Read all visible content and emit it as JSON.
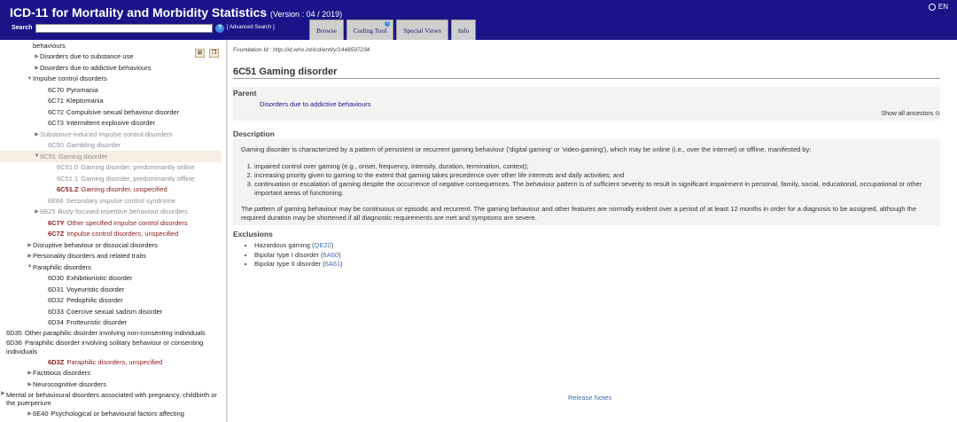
{
  "header": {
    "title": "ICD-11 for Mortality and Morbidity Statistics",
    "version": "(Version : 04 / 2019)",
    "language": "EN",
    "search_label": "Search",
    "search_value": "",
    "help": "?",
    "advanced_search": "[ Advanced Search ]",
    "tabs": [
      {
        "label": "Browse"
      },
      {
        "label": "Coding Tool"
      },
      {
        "label": "Special Views"
      },
      {
        "label": "Info"
      }
    ]
  },
  "tree": [
    {
      "level": 1,
      "toggle": "",
      "code": "",
      "label": "behaviours",
      "style": ""
    },
    {
      "level": 2,
      "toggle": "▶",
      "code": "",
      "label": "Disorders due to substance use",
      "style": ""
    },
    {
      "level": 2,
      "toggle": "▶",
      "code": "",
      "label": "Disorders due to addictive behaviours",
      "style": ""
    },
    {
      "level": 1,
      "toggle": "▼",
      "code": "",
      "label": "Impulse control disorders",
      "style": ""
    },
    {
      "level": 3,
      "toggle": "",
      "code": "6C70",
      "label": "Pyromania",
      "style": ""
    },
    {
      "level": 3,
      "toggle": "",
      "code": "6C71",
      "label": "Kleptomania",
      "style": ""
    },
    {
      "level": 3,
      "toggle": "",
      "code": "6C72",
      "label": "Compulsive sexual behaviour disorder",
      "style": ""
    },
    {
      "level": 3,
      "toggle": "",
      "code": "6C73",
      "label": "Intermittent explosive disorder",
      "style": ""
    },
    {
      "level": 2,
      "toggle": "▶",
      "code": "",
      "label": "Substance-induced impulse control disorders",
      "style": "grey"
    },
    {
      "level": 3,
      "toggle": "",
      "code": "6C50",
      "label": "Gambling disorder",
      "style": "grey"
    },
    {
      "level": 2,
      "toggle": "▼",
      "code": "6C51",
      "label": "Gaming disorder",
      "style": "grey sel"
    },
    {
      "level": 4,
      "toggle": "",
      "code": "6C51.0",
      "label": "Gaming disorder, predominantly online",
      "style": "grey"
    },
    {
      "level": 4,
      "toggle": "",
      "code": "6C51.1",
      "label": "Gaming disorder, predominantly offline",
      "style": "grey"
    },
    {
      "level": 4,
      "toggle": "",
      "code": "6C51.Z",
      "label": "Gaming disorder, unspecified",
      "style": "red"
    },
    {
      "level": 3,
      "toggle": "",
      "code": "6E66",
      "label": "Secondary impulse control syndrome",
      "style": "grey"
    },
    {
      "level": 2,
      "toggle": "▶",
      "code": "6B25",
      "label": "Body-focused repetitive behaviour disorders",
      "style": "grey"
    },
    {
      "level": 3,
      "toggle": "",
      "code": "6C7Y",
      "label": "Other specified impulse control disorders",
      "style": "red"
    },
    {
      "level": 3,
      "toggle": "",
      "code": "6C7Z",
      "label": "Impulse control disorders, unspecified",
      "style": "red"
    },
    {
      "level": 1,
      "toggle": "▶",
      "code": "",
      "label": "Disruptive behaviour or dissocial disorders",
      "style": ""
    },
    {
      "level": 1,
      "toggle": "▶",
      "code": "",
      "label": "Personality disorders and related traits",
      "style": ""
    },
    {
      "level": 1,
      "toggle": "▼",
      "code": "",
      "label": "Paraphilic disorders",
      "style": ""
    },
    {
      "level": 3,
      "toggle": "",
      "code": "6D30",
      "label": "Exhibitionistic disorder",
      "style": ""
    },
    {
      "level": 3,
      "toggle": "",
      "code": "6D31",
      "label": "Voyeuristic disorder",
      "style": ""
    },
    {
      "level": 3,
      "toggle": "",
      "code": "6D32",
      "label": "Pedophilic disorder",
      "style": ""
    },
    {
      "level": 3,
      "toggle": "",
      "code": "6D33",
      "label": "Coercive sexual sadism disorder",
      "style": ""
    },
    {
      "level": 3,
      "toggle": "",
      "code": "6D34",
      "label": "Frotteuristic disorder",
      "style": ""
    },
    {
      "level": 3,
      "toggle": "",
      "code": "6D35",
      "label": "Other paraphilic disorder involving non-consenting individuals",
      "style": "",
      "multi": true
    },
    {
      "level": 3,
      "toggle": "",
      "code": "6D36",
      "label": "Paraphilic disorder involving solitary behaviour or consenting individuals",
      "style": "",
      "multi": true
    },
    {
      "level": 3,
      "toggle": "",
      "code": "6D3Z",
      "label": "Paraphilic disorders, unspecified",
      "style": "red"
    },
    {
      "level": 1,
      "toggle": "▶",
      "code": "",
      "label": "Factitious disorders",
      "style": ""
    },
    {
      "level": 1,
      "toggle": "▶",
      "code": "",
      "label": "Neurocognitive disorders",
      "style": ""
    },
    {
      "level": 1,
      "toggle": "▶",
      "code": "",
      "label": "Mental or behavioural disorders associated with pregnancy, childbirth or the puerperium",
      "style": "",
      "multi": true
    },
    {
      "level": 1,
      "toggle": "▶",
      "code": "6E40",
      "label": "Psychological or behavioural factors affecting",
      "style": ""
    }
  ],
  "detail": {
    "foundation_id": "Foundation Id : http://id.who.int/icd/entity/1448597234",
    "title": "6C51 Gaming disorder",
    "parent_heading": "Parent",
    "parent_link": "Disorders due to addictive behaviours",
    "show_ancestors": "Show all ancestors ⊙",
    "description_heading": "Description",
    "description_intro": "Gaming disorder is characterized by a pattern of persistent or recurrent gaming behaviour ('digital gaming' or 'video-gaming'), which may be online (i.e., over the internet) or offline, manifested by:",
    "description_items": [
      "impaired control over gaming (e.g., onset, frequency, intensity, duration, termination, context);",
      "increasing priority given to gaming to the extent that gaming takes precedence over other life interests and daily activities; and",
      "continuation or escalation of gaming despite the occurrence of negative consequences. The behaviour pattern is of sufficient severity to result in significant impairment in personal, family, social, educational, occupational or other important areas of functioning."
    ],
    "description_outro": "The pattern of gaming behaviour may be continuous or episodic and recurrent. The gaming behaviour and other features are normally evident over a period of at least 12 months in order for a diagnosis to be assigned, although the required duration may be shortened if all diagnostic requirements are met and symptoms are severe.",
    "exclusions_heading": "Exclusions",
    "exclusions": [
      {
        "label": "Hazardous gaming",
        "code": "QE22"
      },
      {
        "label": "Bipolar type I disorder",
        "code": "6A60"
      },
      {
        "label": "Bipolar type II disorder",
        "code": "6A61"
      }
    ],
    "release_notes": "Release Notes"
  }
}
